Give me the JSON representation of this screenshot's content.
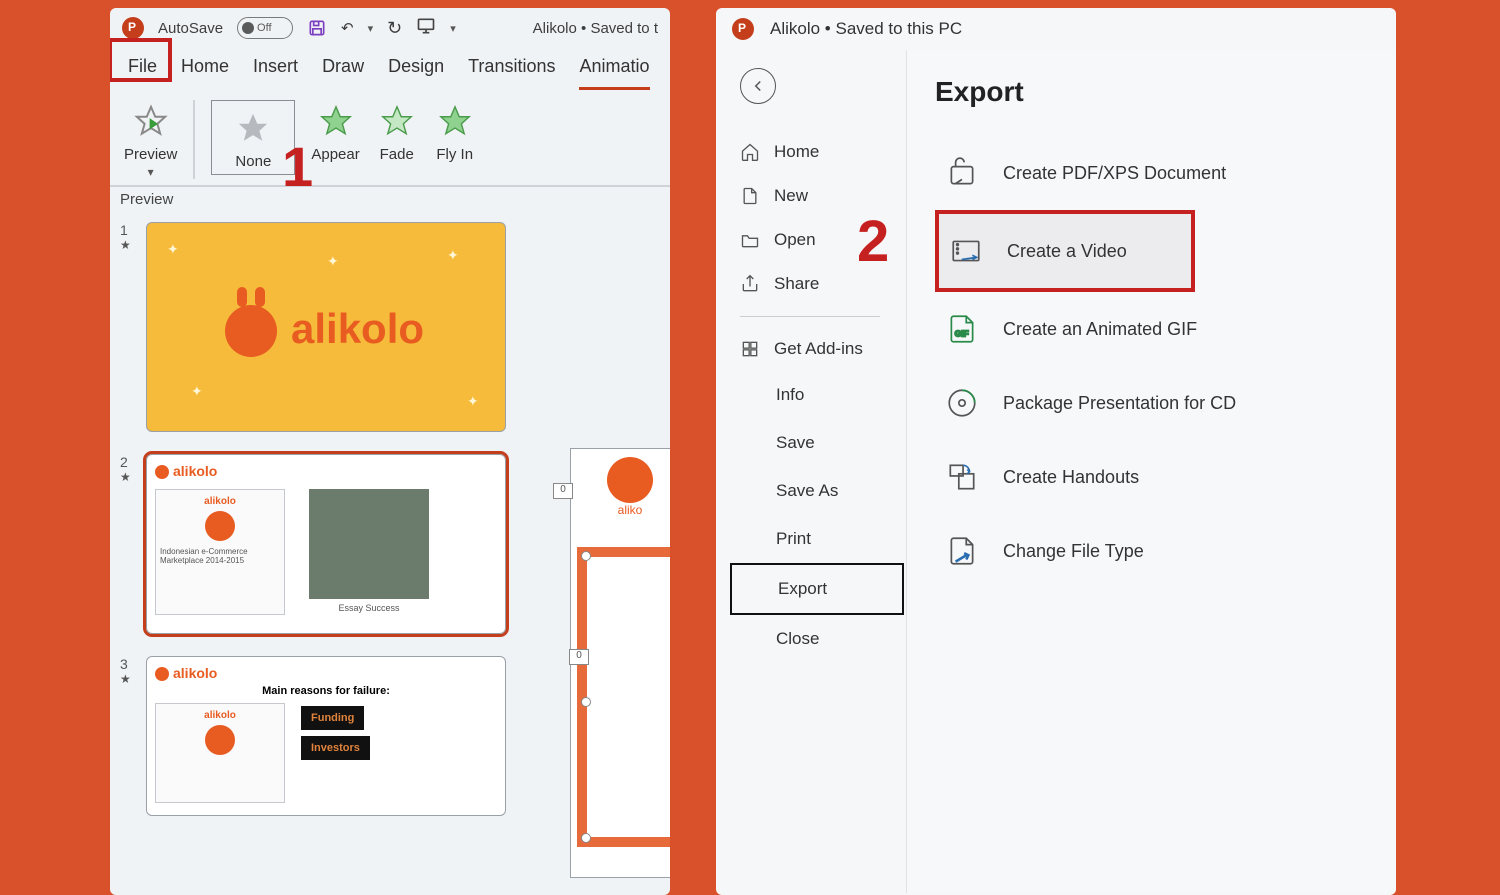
{
  "left": {
    "autosave_label": "AutoSave",
    "autosave_state": "Off",
    "doc_title": "Alikolo • Saved to t",
    "tabs": [
      "File",
      "Home",
      "Insert",
      "Draw",
      "Design",
      "Transitions",
      "Animatio"
    ],
    "active_tab": "Animatio",
    "highlighted_tab": "File",
    "ribbon": {
      "preview": "Preview",
      "preview_group": "Preview",
      "effects": [
        {
          "label": "None",
          "fill": "#b6b9bd"
        },
        {
          "label": "Appear",
          "fill": "#6fbf6f"
        },
        {
          "label": "Fade",
          "fill": "#6fbf6f"
        },
        {
          "label": "Fly In",
          "fill": "#6fbf6f"
        }
      ]
    },
    "step_marker": "1",
    "slides": [
      {
        "num": "1",
        "brand": "alikolo"
      },
      {
        "num": "2",
        "brand": "alikolo",
        "card_title": "alikolo",
        "card_sub": "Indonesian e-Commerce Marketplace 2014-2015",
        "caption": "Essay Success"
      },
      {
        "num": "3",
        "brand": "alikolo",
        "title": "Main reasons for failure:",
        "chips": [
          "Funding",
          "Investors"
        ]
      }
    ],
    "canvas": {
      "logo_text": "aliko",
      "handle_tag": "0",
      "top_tag": "0"
    }
  },
  "right": {
    "doc_title": "Alikolo • Saved to this PC",
    "nav": {
      "home": "Home",
      "new": "New",
      "open": "Open",
      "share": "Share",
      "addins": "Get Add-ins",
      "plain": [
        "Info",
        "Save",
        "Save As",
        "Print",
        "Export",
        "Close"
      ],
      "selected": "Export"
    },
    "heading": "Export",
    "step_marker": "2",
    "options": [
      "Create PDF/XPS Document",
      "Create a Video",
      "Create an Animated GIF",
      "Package Presentation for CD",
      "Create Handouts",
      "Change File Type"
    ],
    "selected_option": "Create a Video"
  }
}
